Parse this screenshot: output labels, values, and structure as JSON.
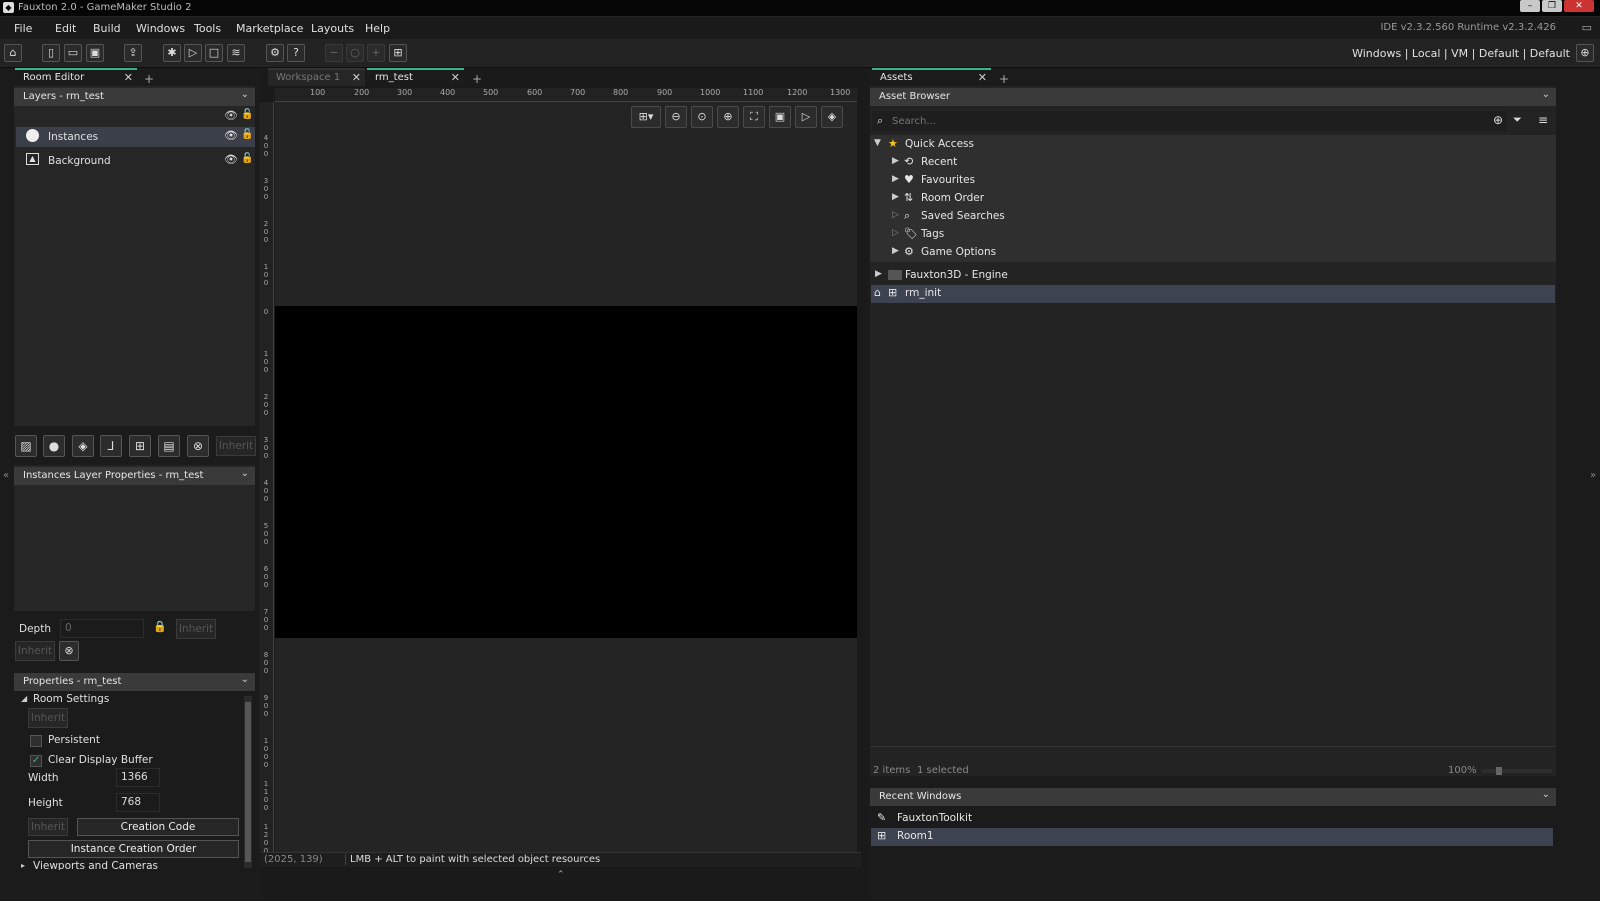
{
  "window": {
    "title": "Fauxton 2.0 - GameMaker Studio 2"
  },
  "menu": {
    "items": [
      "File",
      "Edit",
      "Build",
      "Windows",
      "Tools",
      "Marketplace",
      "Layouts",
      "Help"
    ],
    "version": "IDE v2.3.2.560  Runtime v2.3.2.426"
  },
  "targets": {
    "platform": "Windows",
    "dest": "Local",
    "output": "VM",
    "config1": "Default",
    "config2": "Default",
    "sep": "|"
  },
  "room_editor": {
    "tab_label": "Room Editor",
    "layers_header": "Layers - rm_test",
    "layers": [
      {
        "name": "Instances",
        "icon": "instance-layer-icon"
      },
      {
        "name": "Background",
        "icon": "background-layer-icon"
      }
    ],
    "inherit_label": "Inherit",
    "layer_props_header": "Instances Layer Properties - rm_test",
    "depth_label": "Depth",
    "depth_value": "0",
    "properties_header": "Properties - rm_test",
    "room_settings_label": "Room Settings",
    "persistent_label": "Persistent",
    "clear_display_label": "Clear Display Buffer",
    "width_label": "Width",
    "width_value": "1366",
    "height_label": "Height",
    "height_value": "768",
    "creation_code_label": "Creation Code",
    "instance_order_label": "Instance Creation Order",
    "viewports_label": "Viewports and Cameras"
  },
  "workspace": {
    "tabs": [
      {
        "label": "Workspace 1",
        "active": false
      },
      {
        "label": "rm_test",
        "active": true
      }
    ],
    "ruler_h": [
      "100",
      "200",
      "300",
      "400",
      "500",
      "600",
      "700",
      "800",
      "900",
      "1000",
      "1100",
      "1200",
      "1300"
    ],
    "ruler_v": [
      "4 0 0",
      "3 0 0",
      "2 0 0",
      "1 0 0",
      "0",
      "1 0 0",
      "2 0 0",
      "3 0 0",
      "4 0 0",
      "5 0 0",
      "6 0 0",
      "7 0 0",
      "8 0 0",
      "9 0 0",
      "1 0 0 0",
      "1 1 0 0",
      "1 2 0 0"
    ],
    "status_coords": "(2025, 139)",
    "status_hint": "LMB + ALT to paint with selected object resources"
  },
  "assets": {
    "tab_label": "Assets",
    "browser_header": "Asset Browser",
    "search_placeholder": "Search...",
    "quick_access": "Quick Access",
    "quick_items": [
      {
        "label": "Recent",
        "icon": "recent-icon"
      },
      {
        "label": "Favourites",
        "icon": "heart-icon"
      },
      {
        "label": "Room Order",
        "icon": "room-order-icon"
      },
      {
        "label": "Saved Searches",
        "icon": "search-icon"
      },
      {
        "label": "Tags",
        "icon": "tag-icon"
      },
      {
        "label": "Game Options",
        "icon": "gear-icon"
      }
    ],
    "folder": "Fauxton3D - Engine",
    "room": "rm_init",
    "items_count": "2 items",
    "selected_count": "1 selected",
    "zoom": "100%",
    "recent_header": "Recent Windows",
    "recent_items": [
      "FauxtonToolkit",
      "Room1"
    ]
  },
  "colors": {
    "accent": "#3ab486",
    "selection": "#3a3f4a"
  }
}
